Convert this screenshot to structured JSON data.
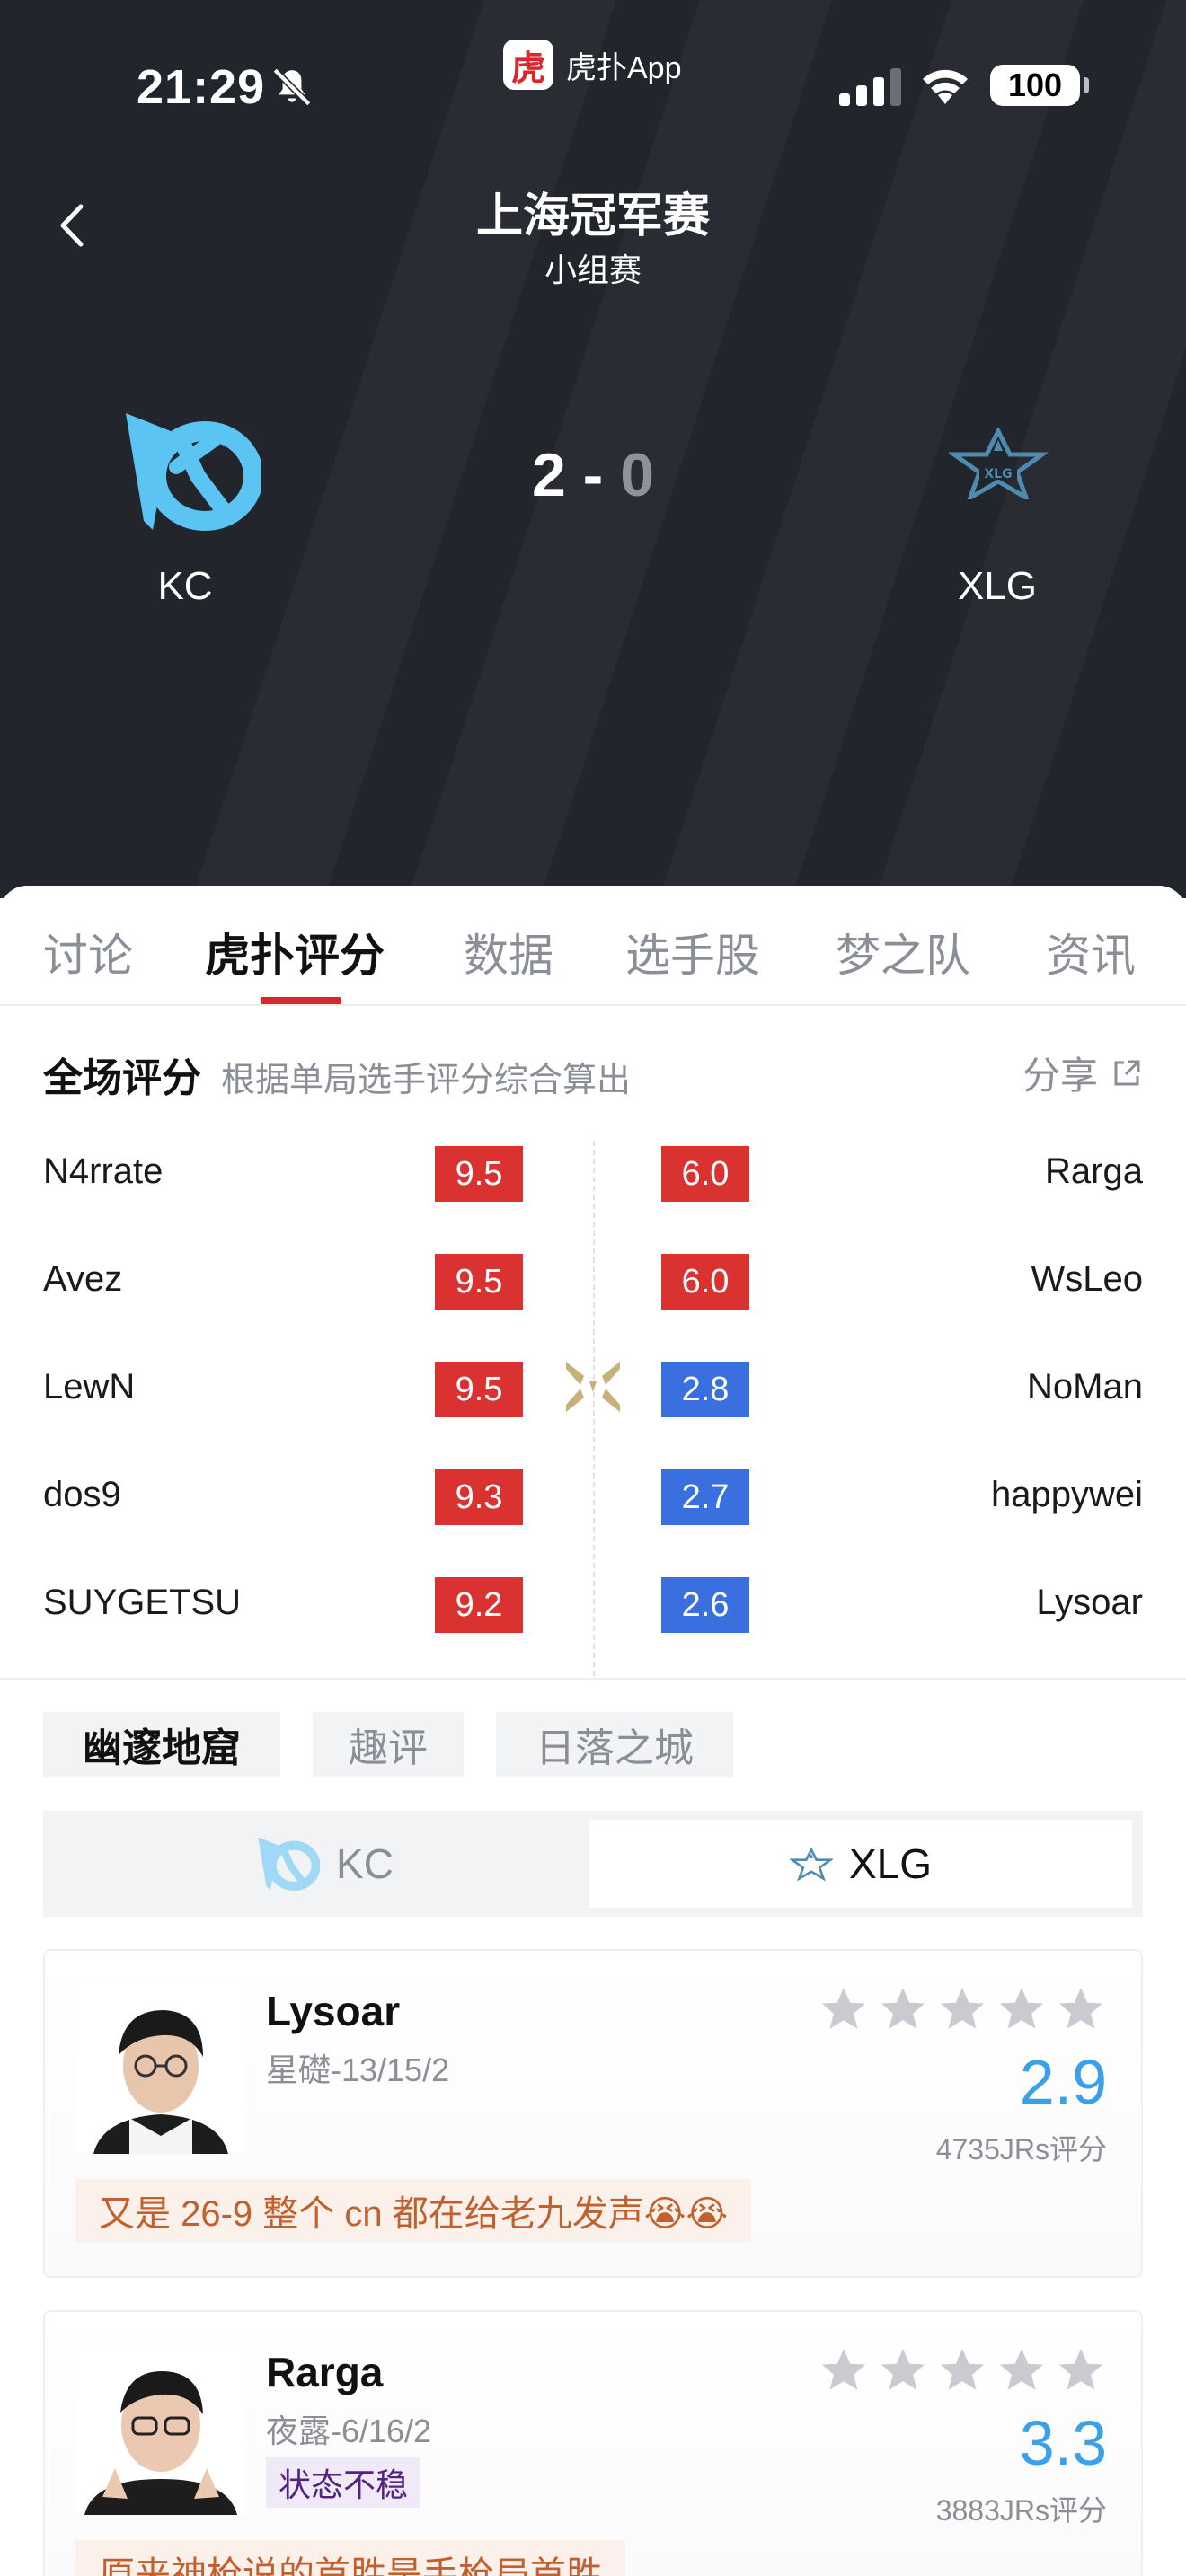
{
  "status_bar": {
    "time": "21:29",
    "app_name": "虎扑App",
    "app_logo_char": "虎",
    "battery": "100"
  },
  "match": {
    "title": "上海冠军赛",
    "subtitle": "小组赛",
    "team_left": {
      "name": "KC",
      "score": "2",
      "color": "#4fc3f7"
    },
    "separator": "-",
    "team_right": {
      "name": "XLG",
      "score": "0"
    }
  },
  "tabs": [
    {
      "label": "讨论"
    },
    {
      "label": "虎扑评分",
      "active": true
    },
    {
      "label": "数据"
    },
    {
      "label": "选手股"
    },
    {
      "label": "梦之队"
    },
    {
      "label": "资讯"
    }
  ],
  "ratings": {
    "title": "全场评分",
    "description": "根据单局选手评分综合算出",
    "share_label": "分享",
    "rows": [
      {
        "left_player": "N4rrate",
        "left_score": "9.5",
        "right_score": "6.0",
        "right_player": "Rarga",
        "right_color": "red"
      },
      {
        "left_player": "Avez",
        "left_score": "9.5",
        "right_score": "6.0",
        "right_player": "WsLeo",
        "right_color": "red"
      },
      {
        "left_player": "LewN",
        "left_score": "9.5",
        "right_score": "2.8",
        "right_player": "NoMan",
        "right_color": "blue"
      },
      {
        "left_player": "dos9",
        "left_score": "9.3",
        "right_score": "2.7",
        "right_player": "happywei",
        "right_color": "blue"
      },
      {
        "left_player": "SUYGETSU",
        "left_score": "9.2",
        "right_score": "2.6",
        "right_player": "Lysoar",
        "right_color": "blue"
      }
    ]
  },
  "maps": [
    {
      "label": "幽邃地窟",
      "active": true
    },
    {
      "label": "趣评"
    },
    {
      "label": "日落之城"
    }
  ],
  "team_switch": {
    "left": "KC",
    "right": "XLG",
    "selected": "XLG"
  },
  "players": [
    {
      "name": "Lysoar",
      "hero_stats": "星礎-13/15/2",
      "tag": "",
      "score": "2.9",
      "count": "4735JRs评分",
      "comment": "又是 26-9 整个 cn 都在给老九发声😭😭"
    },
    {
      "name": "Rarga",
      "hero_stats": "夜露-6/16/2",
      "tag": "状态不稳",
      "score": "3.3",
      "count": "3883JRs评分",
      "comment": "原来神枪说的首胜是手枪局首胜"
    }
  ]
}
